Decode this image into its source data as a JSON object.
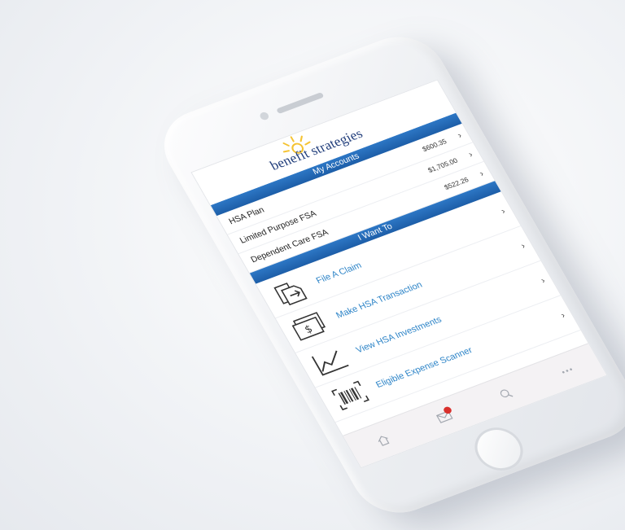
{
  "logo": {
    "text": "benefit strategies"
  },
  "accounts": {
    "title": "My Accounts",
    "items": [
      {
        "name": "HSA Plan",
        "amount": "$600.35"
      },
      {
        "name": "Limited Purpose FSA",
        "amount": "$1,705.00"
      },
      {
        "name": "Dependent Care FSA",
        "amount": "$522.26"
      }
    ]
  },
  "actions": {
    "title": "I Want To",
    "items": [
      {
        "label": "File A Claim",
        "icon": "file-claim-icon"
      },
      {
        "label": "Make HSA Transaction",
        "icon": "dollar-bill-icon"
      },
      {
        "label": "View HSA Investments",
        "icon": "line-chart-icon"
      },
      {
        "label": "Eligible Expense Scanner",
        "icon": "barcode-scanner-icon"
      }
    ]
  },
  "tabbar": {
    "icons": [
      "home-icon",
      "envelope-icon",
      "search-icon",
      "more-icon"
    ]
  },
  "colors": {
    "section_bar": "#2470bd",
    "action_text": "#2b83c7",
    "logo_text": "#1f3c7a",
    "logo_sun": "#f5c332",
    "badge": "#d9302c"
  }
}
